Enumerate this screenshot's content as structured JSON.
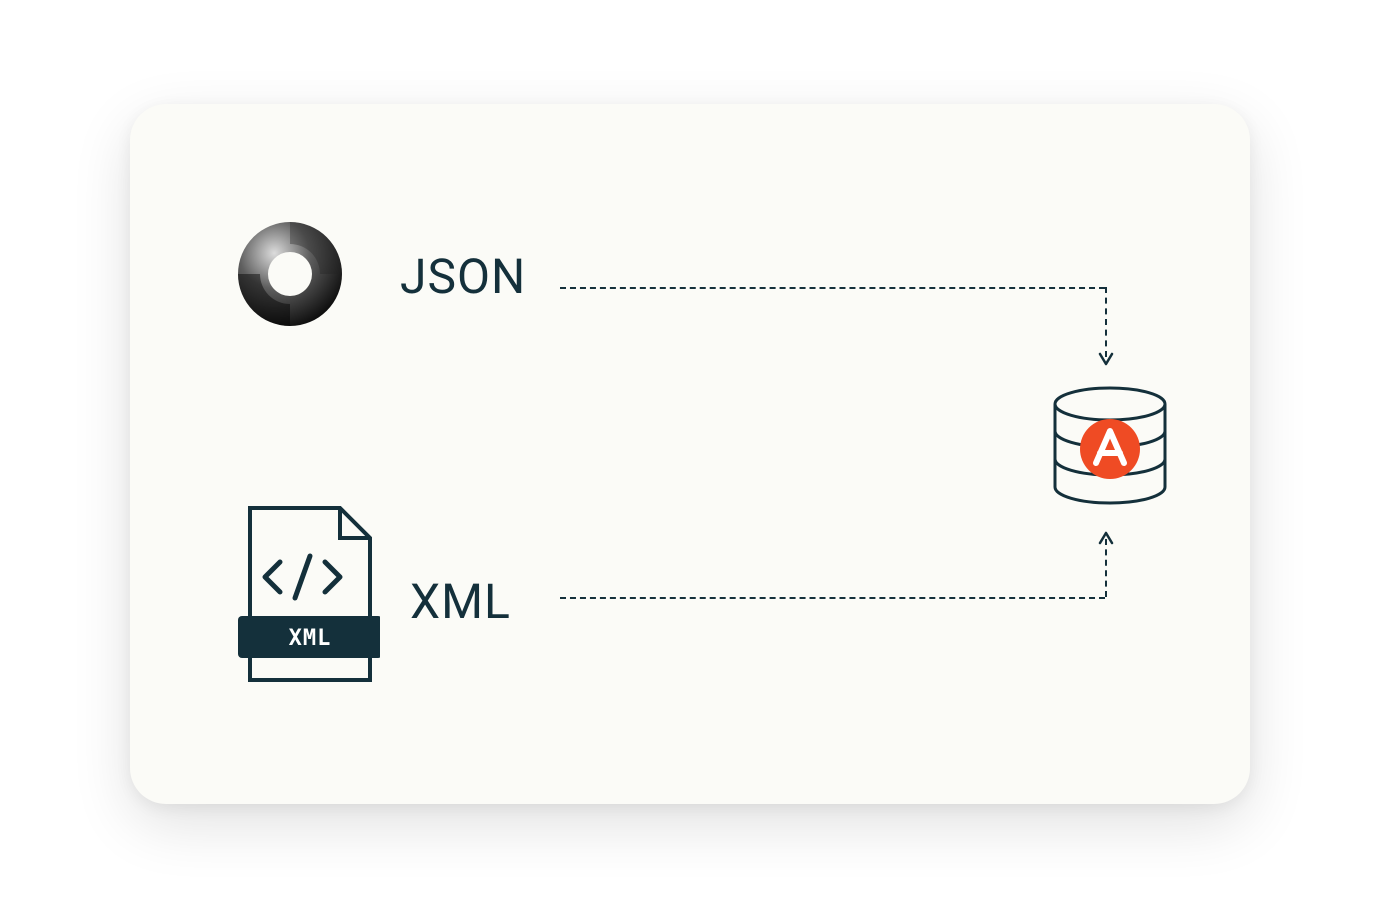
{
  "sources": {
    "json": {
      "label": "JSON"
    },
    "xml": {
      "label": "XML",
      "badge": "XML"
    }
  },
  "target": {
    "name": "database",
    "brand_color": "#ef4b24"
  },
  "colors": {
    "ink": "#14303b",
    "card_bg": "#fbfbf7",
    "accent": "#ef4b24"
  }
}
